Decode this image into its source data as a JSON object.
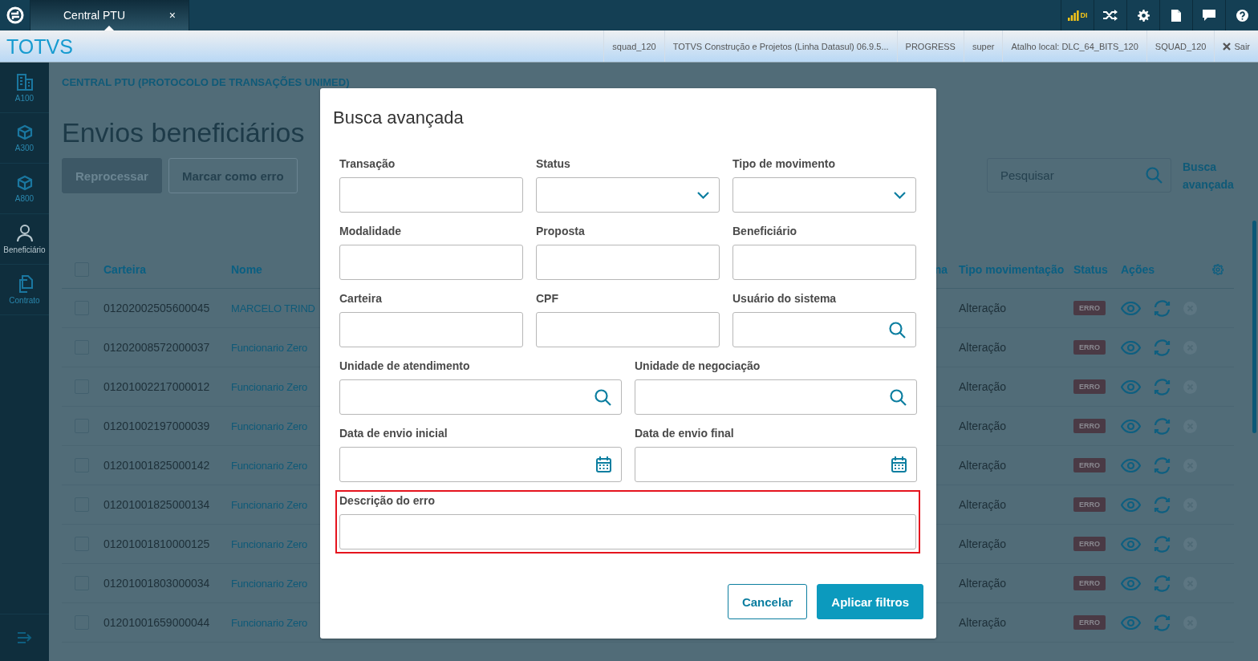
{
  "topbar": {
    "tab": {
      "label": "Central PTU",
      "close": "×",
      "selected": true
    },
    "indicator": "DI"
  },
  "header": {
    "brand": "TOTVS",
    "items": [
      "squad_120",
      "TOTVS Construção e Projetos (Linha Datasul) 06.9.5...",
      "PROGRESS",
      "super",
      "Atalho local: DLC_64_BITS_120",
      "SQUAD_120"
    ],
    "logout": "Sair"
  },
  "sidebar": {
    "items": [
      {
        "label": "A100",
        "kind": "building",
        "selected": false
      },
      {
        "label": "A300",
        "kind": "cube",
        "selected": false
      },
      {
        "label": "A800",
        "kind": "cube",
        "selected": false
      },
      {
        "label": "Beneficiário",
        "kind": "person",
        "selected": true
      },
      {
        "label": "Contrato",
        "kind": "documents",
        "selected": false
      }
    ]
  },
  "page": {
    "breadcrumb": "CENTRAL PTU (PROTOCOLO DE TRANSAÇÕES UNIMED)",
    "title": "Envios beneficiários",
    "actions": [
      {
        "label": "Reprocessar",
        "kind": "primary"
      },
      {
        "label": "Marcar como erro",
        "kind": "secondary"
      }
    ],
    "search": {
      "placeholder": "Pesquisar"
    },
    "advanced_link": "Busca avançada"
  },
  "table": {
    "all_selected": false,
    "columns": [
      "Carteira",
      "Nome",
      "na",
      "Tipo movimentação",
      "Status",
      "Ações"
    ],
    "rows": [
      {
        "selected": false,
        "carteira": "01202002505600045",
        "nome": "MARCELO TRIND",
        "tipo": "Alteração",
        "status": "ERRO"
      },
      {
        "selected": false,
        "carteira": "01202008572000037",
        "nome": "Funcionario Zero",
        "tipo": "Alteração",
        "status": "ERRO"
      },
      {
        "selected": false,
        "carteira": "01201002217000012",
        "nome": "Funcionario Zero",
        "tipo": "Alteração",
        "status": "ERRO"
      },
      {
        "selected": false,
        "carteira": "01201002197000039",
        "nome": "Funcionario Zero",
        "tipo": "Alteração",
        "status": "ERRO"
      },
      {
        "selected": false,
        "carteira": "01201001825000142",
        "nome": "Funcionario Zero",
        "tipo": "Alteração",
        "status": "ERRO"
      },
      {
        "selected": false,
        "carteira": "01201001825000134",
        "nome": "Funcionario Zero",
        "tipo": "Alteração",
        "status": "ERRO"
      },
      {
        "selected": false,
        "carteira": "01201001810000125",
        "nome": "Funcionario Zero",
        "tipo": "Alteração",
        "status": "ERRO"
      },
      {
        "selected": false,
        "carteira": "01201001803000034",
        "nome": "Funcionario Zero",
        "tipo": "Alteração",
        "status": "ERRO"
      },
      {
        "selected": false,
        "carteira": "01201001659000044",
        "nome": "Funcionario Zero",
        "tipo": "Alteração",
        "status": "ERRO"
      }
    ]
  },
  "dialog": {
    "title": "Busca avançada",
    "rows": [
      [
        {
          "label": "Transação",
          "kind": "text",
          "highlighted": false
        },
        {
          "label": "Status",
          "kind": "select",
          "highlighted": false
        },
        {
          "label": "Tipo de movimento",
          "kind": "select",
          "highlighted": false
        }
      ],
      [
        {
          "label": "Modalidade",
          "kind": "text",
          "highlighted": false
        },
        {
          "label": "Proposta",
          "kind": "text",
          "highlighted": false
        },
        {
          "label": "Beneficiário",
          "kind": "text",
          "highlighted": false
        }
      ],
      [
        {
          "label": "Carteira",
          "kind": "text",
          "highlighted": false
        },
        {
          "label": "CPF",
          "kind": "text",
          "highlighted": false
        },
        {
          "label": "Usuário do sistema",
          "kind": "search",
          "highlighted": false
        }
      ],
      [
        {
          "label": "Unidade de atendimento",
          "kind": "search",
          "highlighted": false
        },
        {
          "label": "Unidade de negociação",
          "kind": "search",
          "highlighted": false
        }
      ],
      [
        {
          "label": "Data de envio inicial",
          "kind": "date",
          "highlighted": false
        },
        {
          "label": "Data de envio final",
          "kind": "date",
          "highlighted": false
        }
      ],
      [
        {
          "label": "Descrição do erro",
          "kind": "text",
          "highlighted": true
        }
      ]
    ],
    "buttons": [
      {
        "label": "Cancelar",
        "kind": "secondary"
      },
      {
        "label": "Aplicar filtros",
        "kind": "primary"
      }
    ]
  }
}
